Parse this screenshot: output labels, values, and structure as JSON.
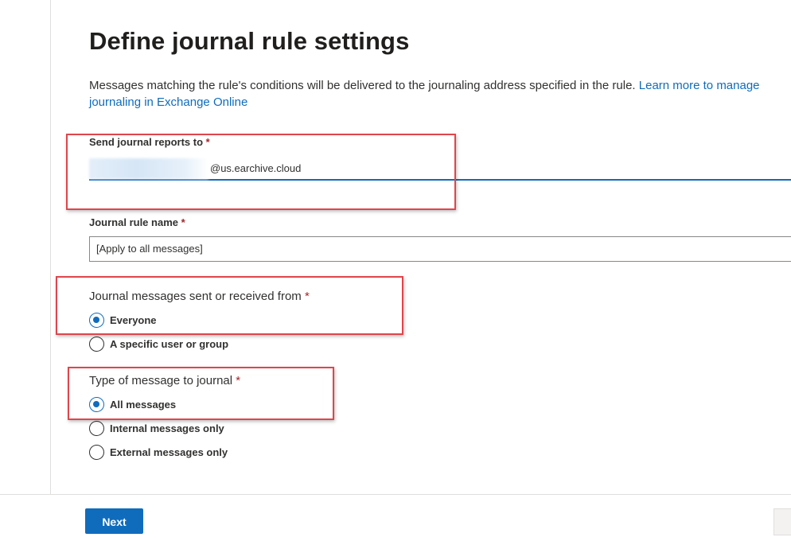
{
  "page": {
    "title": "Define journal rule settings",
    "description_text": "Messages matching the rule's conditions will be delivered to the journaling address specified in the rule.",
    "learn_more_link": "Learn more to manage journaling in Exchange Online"
  },
  "send_reports": {
    "label": "Send journal reports to",
    "required_mark": "*",
    "value_suffix": "@us.earchive.cloud"
  },
  "rule_name": {
    "label": "Journal rule name",
    "required_mark": "*",
    "value": "[Apply to all messages]"
  },
  "sent_received": {
    "label": "Journal messages sent or received from",
    "required_mark": "*",
    "options": [
      "Everyone",
      "A specific user or group"
    ],
    "selected": "Everyone"
  },
  "message_type": {
    "label": "Type of message to journal",
    "required_mark": "*",
    "options": [
      "All messages",
      "Internal messages only",
      "External messages only"
    ],
    "selected": "All messages"
  },
  "footer": {
    "next_label": "Next"
  },
  "colors": {
    "accent": "#0f6cbd",
    "highlight_box": "#e0454b",
    "required": "#a4262c"
  }
}
